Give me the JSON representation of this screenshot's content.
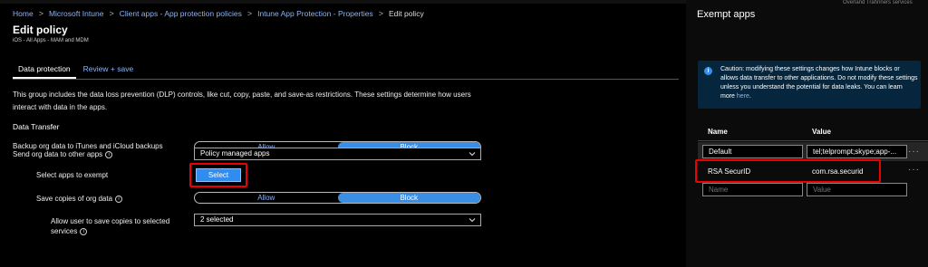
{
  "breadcrumb": [
    "Home",
    "Microsoft Intune",
    "Client apps - App protection policies",
    "Intune App Protection - Properties",
    "Edit policy"
  ],
  "page": {
    "title": "Edit policy",
    "subtitle": "iOS - All Apps - MAM and MDM"
  },
  "tabs": [
    "Data protection",
    "Review + save"
  ],
  "description": "This group includes the data loss prevention (DLP) controls, like cut, copy, paste, and save-as restrictions. These settings determine how users interact with data in the apps.",
  "section_heading": "Data Transfer",
  "settings": {
    "backup": {
      "label": "Backup org data to iTunes and iCloud backups",
      "options": [
        "Allow",
        "Block"
      ],
      "selected": "Block"
    },
    "send_data": {
      "label": "Send org data to other apps",
      "value": "Policy managed apps"
    },
    "exempt": {
      "label": "Select apps to exempt",
      "button_label": "Select"
    },
    "save_copies": {
      "label": "Save copies of org data",
      "options": [
        "Allow",
        "Block"
      ],
      "selected": "Block"
    },
    "allow_save": {
      "label": "Allow user to save copies to selected services",
      "value": "2 selected"
    }
  },
  "panel": {
    "top_text": "Overland Trahnners services",
    "title": "Exempt apps",
    "info": {
      "text": "Caution: modifying these settings changes how Intune blocks or allows data transfer to other applications. Do not modify these settings unless you understand the potential for data leaks. You can learn more",
      "link": "here",
      "end": "."
    },
    "columns": [
      "Name",
      "Value"
    ],
    "rows": [
      {
        "name": "Default",
        "value": "tel;telprompt;skype;app-..."
      },
      {
        "name": "RSA SecurID",
        "value": "com.rsa.securid"
      }
    ],
    "new_row": {
      "name_placeholder": "Name",
      "value_placeholder": "Value"
    },
    "more": "···"
  },
  "colors": {
    "accent": "#3a8ee6",
    "link": "#8ab4f8",
    "highlight": "#e00000",
    "info_bg": "#06263d"
  }
}
